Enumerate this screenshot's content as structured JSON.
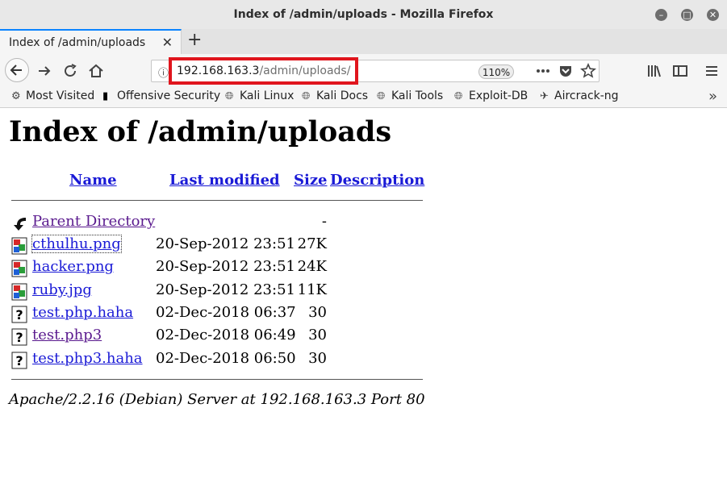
{
  "window": {
    "title": "Index of /admin/uploads - Mozilla Firefox"
  },
  "tab": {
    "title": "Index of /admin/uploads"
  },
  "urlbar": {
    "host": "192.168.163.3",
    "path": "/admin/uploads/",
    "zoom": "110%"
  },
  "bookmarks": [
    {
      "label": "Most Visited",
      "icon": "gear-icon"
    },
    {
      "label": "Offensive Security",
      "icon": "offsec-icon"
    },
    {
      "label": "Kali Linux",
      "icon": "globe-icon"
    },
    {
      "label": "Kali Docs",
      "icon": "globe-icon"
    },
    {
      "label": "Kali Tools",
      "icon": "globe-icon"
    },
    {
      "label": "Exploit-DB",
      "icon": "globe-icon"
    },
    {
      "label": "Aircrack-ng",
      "icon": "aircrack-icon"
    }
  ],
  "page": {
    "heading": "Index of /admin/uploads",
    "columns": {
      "name": "Name",
      "modified": "Last modified",
      "size": "Size",
      "description": "Description"
    },
    "parent": {
      "name": "Parent Directory",
      "size": "-"
    },
    "files": [
      {
        "name": "cthulhu.png",
        "modified": "20-Sep-2012 23:51",
        "size": "27K",
        "type": "image"
      },
      {
        "name": "hacker.png",
        "modified": "20-Sep-2012 23:51",
        "size": "24K",
        "type": "image"
      },
      {
        "name": "ruby.jpg",
        "modified": "20-Sep-2012 23:51",
        "size": "11K",
        "type": "image"
      },
      {
        "name": "test.php.haha",
        "modified": "02-Dec-2018 06:37",
        "size": "30",
        "type": "unknown"
      },
      {
        "name": "test.php3",
        "modified": "02-Dec-2018 06:49",
        "size": "30",
        "type": "unknown"
      },
      {
        "name": "test.php3.haha",
        "modified": "02-Dec-2018 06:50",
        "size": "30",
        "type": "unknown"
      }
    ],
    "footer": "Apache/2.2.16 (Debian) Server at 192.168.163.3 Port 80"
  }
}
